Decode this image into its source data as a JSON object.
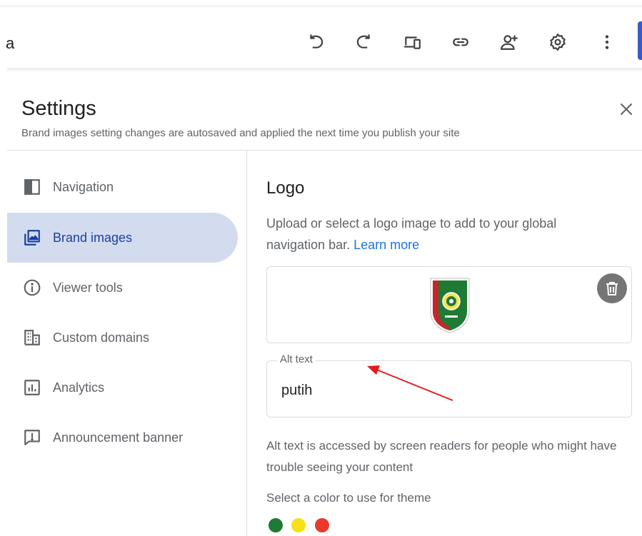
{
  "toolbar": {
    "site_name": "a",
    "icons": [
      "undo-icon",
      "redo-icon",
      "preview-icon",
      "link-icon",
      "share-icon",
      "settings-icon",
      "more-icon"
    ]
  },
  "settings": {
    "title": "Settings",
    "subtitle": "Brand images setting changes are autosaved and applied the next time you publish your site"
  },
  "sidebar": {
    "items": [
      {
        "label": "Navigation",
        "icon": "navigation-icon",
        "active": false
      },
      {
        "label": "Brand images",
        "icon": "brand-images-icon",
        "active": true
      },
      {
        "label": "Viewer tools",
        "icon": "info-icon",
        "active": false
      },
      {
        "label": "Custom domains",
        "icon": "domain-icon",
        "active": false
      },
      {
        "label": "Analytics",
        "icon": "analytics-icon",
        "active": false
      },
      {
        "label": "Announcement banner",
        "icon": "announcement-icon",
        "active": false
      }
    ]
  },
  "logo": {
    "title": "Logo",
    "description": "Upload or select a logo image to add to your global navigation bar.",
    "learn_more": "Learn more"
  },
  "alt_text": {
    "label": "Alt text",
    "value": "putih",
    "help": "Alt text is accessed by screen readers for people who might have trouble seeing your content"
  },
  "theme": {
    "label": "Select a color to use for theme",
    "colors": [
      "#1e7a34",
      "#f5e11a",
      "#e8392b"
    ]
  },
  "colors": {
    "active_nav_bg": "#d3dcef",
    "active_nav_text": "#1a3f9e",
    "link": "#1a73e8",
    "annotation_arrow": "#e31b1b"
  }
}
